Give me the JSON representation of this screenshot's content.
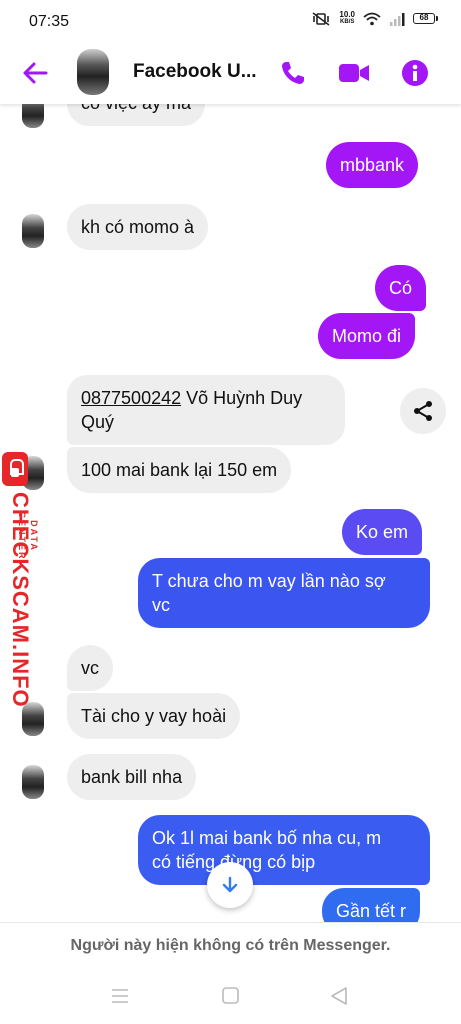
{
  "status_bar": {
    "time": "07:35",
    "net_speed_value": "10.0",
    "net_speed_unit": "KB/S",
    "battery": "68"
  },
  "header": {
    "title": "Facebook U...",
    "accent_color": "#a316f6"
  },
  "messages": {
    "m0": "có việc ấy mà",
    "m1": "mbbank",
    "m2": "kh có momo à",
    "m3": "Có",
    "m4": "Momo đi",
    "m5_phone": "0877500242",
    "m5_name": " Võ Huỳnh Duy",
    "m5_line2": "Quý",
    "m6": "100 mai bank lại 150 em",
    "m7": "Ko em",
    "m8_line1": "T chưa cho m vay lần nào sợ",
    "m8_line2": "vc",
    "m9": "vc",
    "m10": "Tài cho y vay hoài",
    "m11": "bank bill nha",
    "m12_line1": "Ok 1l mai bank bố nha cu, m",
    "m12_line2": "có tiếng đừng có bịp",
    "m13": "Gần tết r"
  },
  "watermark": {
    "main": "CHECKSCAM.INFO",
    "sub": "DATA CENTER"
  },
  "footer": {
    "notice": "Người này hiện không có trên Messenger."
  },
  "icons": {
    "back": "arrow-left-icon",
    "call": "phone-icon",
    "video": "video-camera-icon",
    "info": "info-icon",
    "share": "share-icon",
    "scroll_down": "arrow-down-icon"
  }
}
